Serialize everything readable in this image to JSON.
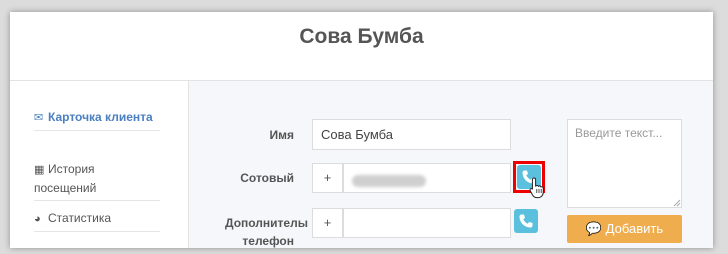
{
  "header": {
    "title": "Сова Бумба"
  },
  "sidebar": {
    "items": [
      {
        "label": "Карточка клиента",
        "icon": "envelope-icon",
        "active": true
      },
      {
        "label": "История посещений",
        "icon": "table-icon",
        "active": false
      },
      {
        "label": "Статистика",
        "icon": "pie-chart-icon",
        "active": false
      }
    ]
  },
  "form": {
    "name": {
      "label": "Имя",
      "value": "Сова Бумба"
    },
    "mobile": {
      "label": "Сотовый",
      "prefix": "+",
      "value": ""
    },
    "extra_phone": {
      "label_line1": "Дополнителы",
      "label_line2": "телефон",
      "prefix": "+",
      "value": ""
    }
  },
  "comment": {
    "placeholder": "Введите текст..."
  },
  "add_button": {
    "icon": "comment-icon",
    "label": "Добавить"
  },
  "colors": {
    "accent": "#4a7fc0",
    "phone_button": "#5bc0de",
    "add_button": "#f0ad4e",
    "highlight": "#ee0000"
  }
}
